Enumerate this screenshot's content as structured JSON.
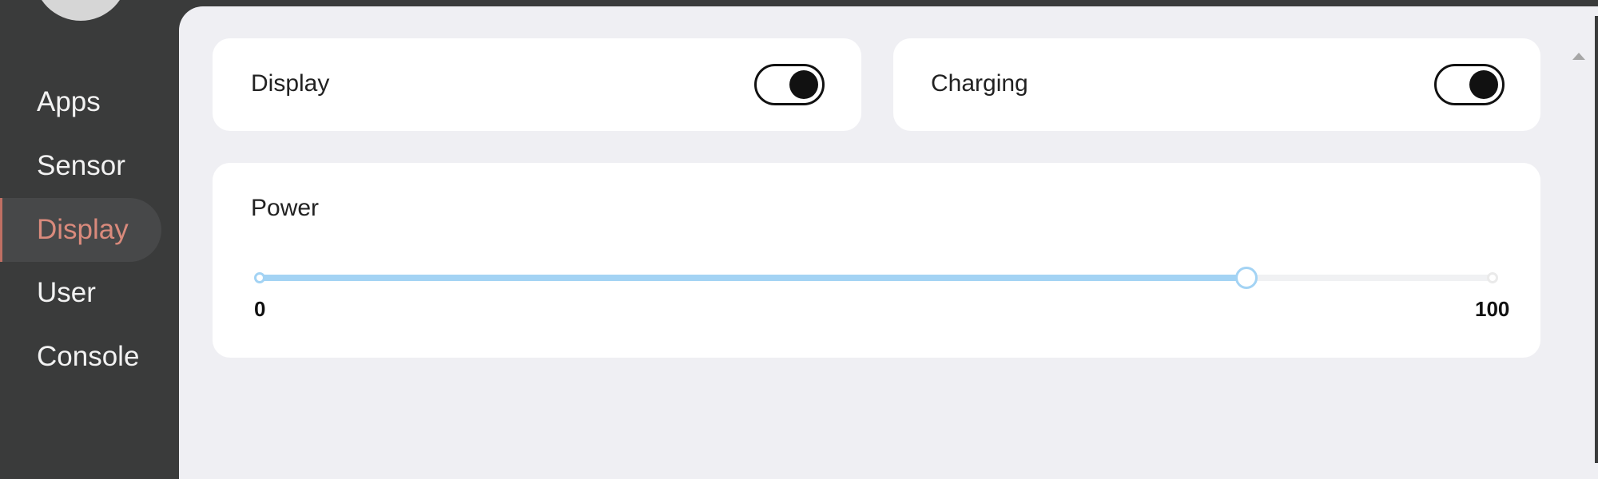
{
  "sidebar": {
    "items": [
      {
        "label": "Apps"
      },
      {
        "label": "Sensor"
      },
      {
        "label": "Display",
        "active": true
      },
      {
        "label": "User"
      },
      {
        "label": "Console"
      }
    ],
    "active_color": "#d98a7c"
  },
  "cards": {
    "display": {
      "label": "Display",
      "toggle_on": true
    },
    "charging": {
      "label": "Charging",
      "toggle_on": true
    },
    "power": {
      "label": "Power",
      "min_label": "0",
      "max_label": "100",
      "min": 0,
      "max": 100,
      "value": 80
    }
  },
  "colors": {
    "slider_accent": "#a3d3f4",
    "panel_bg": "#efeff3",
    "sidebar_bg": "#3a3b3b"
  }
}
